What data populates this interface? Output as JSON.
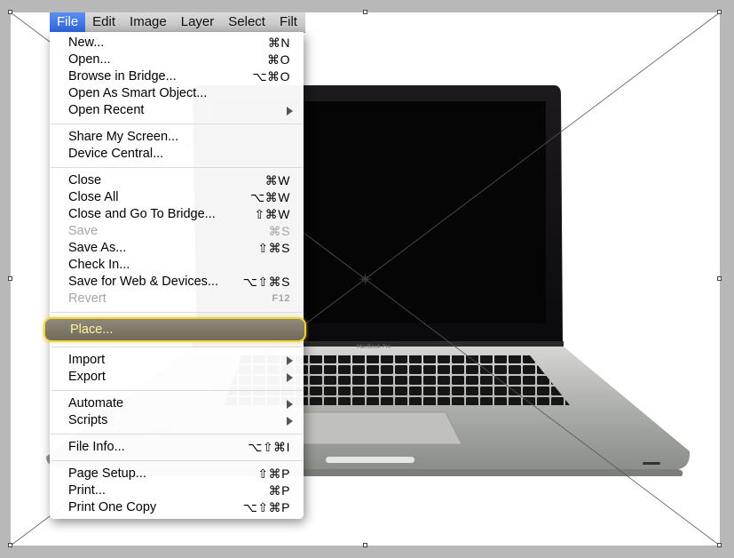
{
  "menubar": {
    "items": [
      "File",
      "Edit",
      "Image",
      "Layer",
      "Select",
      "Filt"
    ],
    "active_index": 0
  },
  "file_menu": {
    "groups": [
      [
        {
          "label": "New...",
          "shortcut": "⌘N"
        },
        {
          "label": "Open...",
          "shortcut": "⌘O"
        },
        {
          "label": "Browse in Bridge...",
          "shortcut": "⌥⌘O"
        },
        {
          "label": "Open As Smart Object...",
          "shortcut": ""
        },
        {
          "label": "Open Recent",
          "shortcut": "",
          "submenu": true
        }
      ],
      [
        {
          "label": "Share My Screen...",
          "shortcut": ""
        },
        {
          "label": "Device Central...",
          "shortcut": ""
        }
      ],
      [
        {
          "label": "Close",
          "shortcut": "⌘W"
        },
        {
          "label": "Close All",
          "shortcut": "⌥⌘W"
        },
        {
          "label": "Close and Go To Bridge...",
          "shortcut": "⇧⌘W"
        },
        {
          "label": "Save",
          "shortcut": "⌘S",
          "disabled": true
        },
        {
          "label": "Save As...",
          "shortcut": "⇧⌘S"
        },
        {
          "label": "Check In...",
          "shortcut": ""
        },
        {
          "label": "Save for Web & Devices...",
          "shortcut": "⌥⇧⌘S"
        },
        {
          "label": "Revert",
          "shortcut": "F12",
          "disabled": true
        }
      ],
      [
        {
          "label": "Place...",
          "shortcut": "",
          "highlighted": true
        }
      ],
      [
        {
          "label": "Import",
          "shortcut": "",
          "submenu": true
        },
        {
          "label": "Export",
          "shortcut": "",
          "submenu": true
        }
      ],
      [
        {
          "label": "Automate",
          "shortcut": "",
          "submenu": true
        },
        {
          "label": "Scripts",
          "shortcut": "",
          "submenu": true
        }
      ],
      [
        {
          "label": "File Info...",
          "shortcut": "⌥⇧⌘I"
        }
      ],
      [
        {
          "label": "Page Setup...",
          "shortcut": "⇧⌘P"
        },
        {
          "label": "Print...",
          "shortcut": "⌘P"
        },
        {
          "label": "Print One Copy",
          "shortcut": "⌥⇧⌘P"
        }
      ]
    ]
  },
  "image": {
    "brand_label": "MacBook Pro"
  },
  "colors": {
    "menu_highlight_border": "#f2d23c",
    "menu_highlight_text": "#fff3a0",
    "active_menubar": "#3b73e6",
    "disabled_text": "#a5a5a5"
  }
}
